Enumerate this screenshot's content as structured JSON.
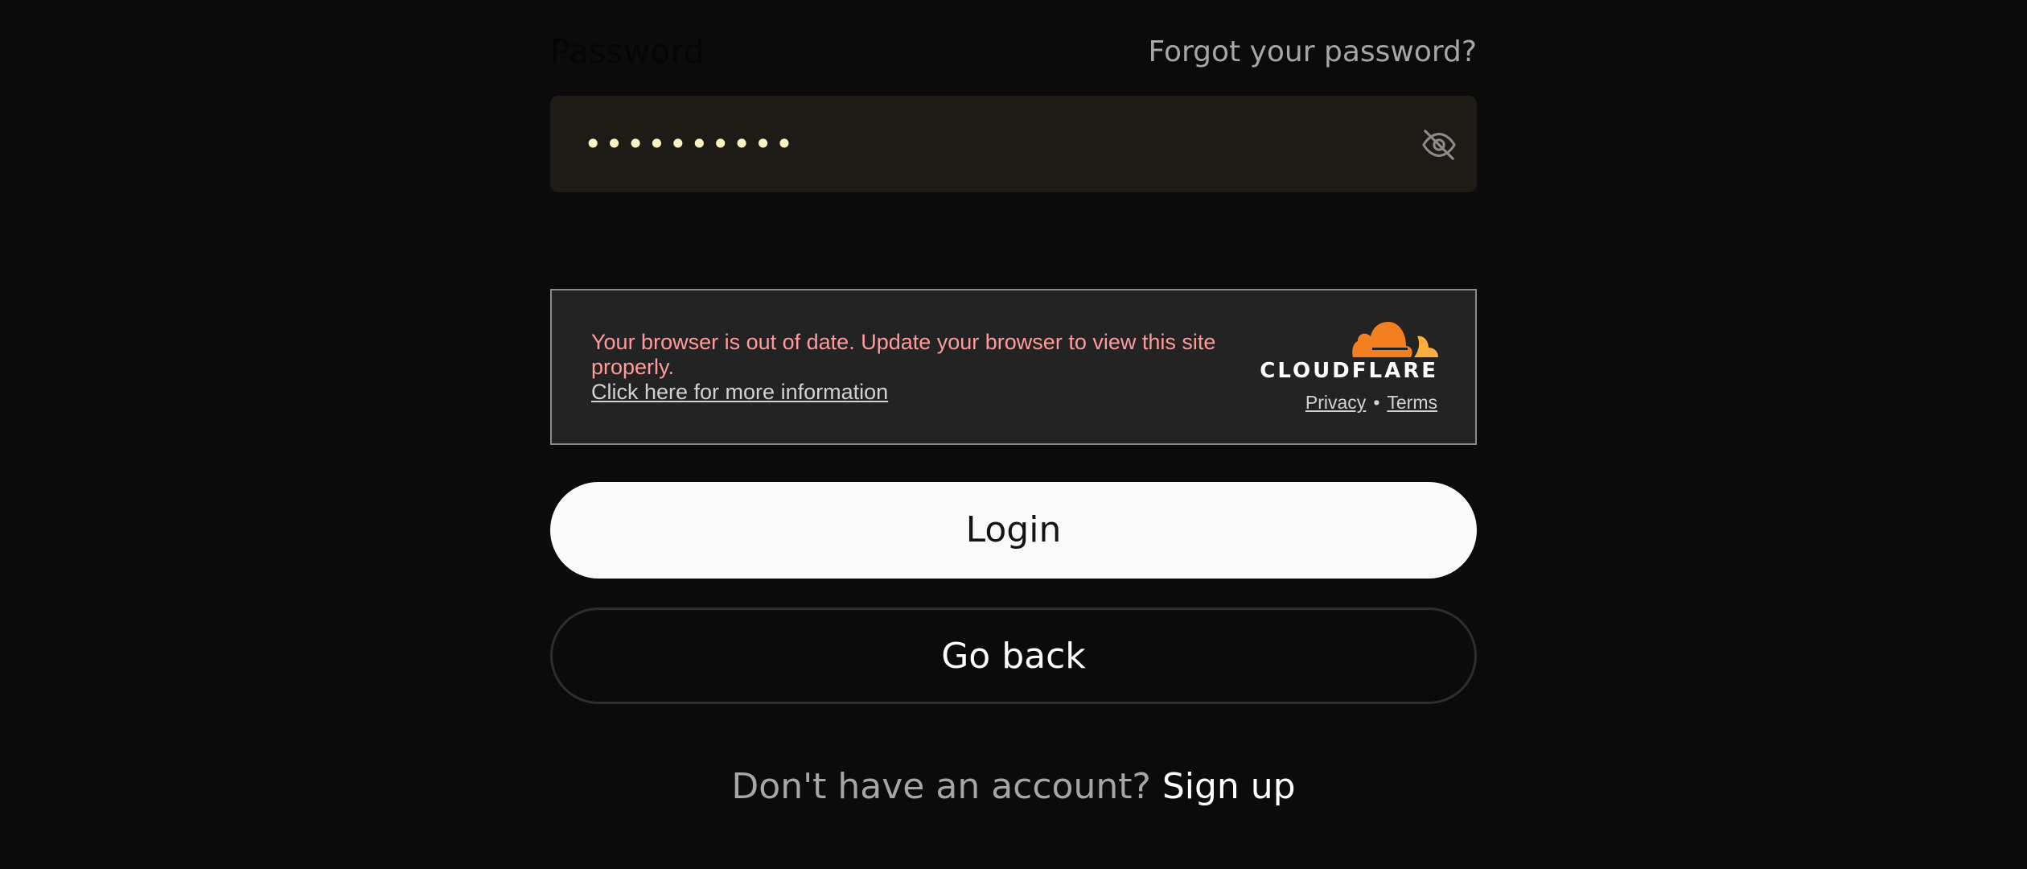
{
  "password": {
    "label": "Password",
    "forgot_link": "Forgot your password?",
    "masked_value": "••••••••••",
    "toggle_icon": "eye-off-icon"
  },
  "cloudflare": {
    "message": "Your browser is out of date. Update your browser to view this site properly.",
    "more_info_link": "Click here for more information",
    "brand": "CLOUDFLARE",
    "privacy_link": "Privacy",
    "separator": "•",
    "terms_link": "Terms",
    "brand_color": "#f38020",
    "brand_color_light": "#faae40",
    "message_color": "#ff9b9b"
  },
  "actions": {
    "login_label": "Login",
    "go_back_label": "Go back"
  },
  "signup": {
    "prompt": "Don't have an account?",
    "link": "Sign up"
  }
}
